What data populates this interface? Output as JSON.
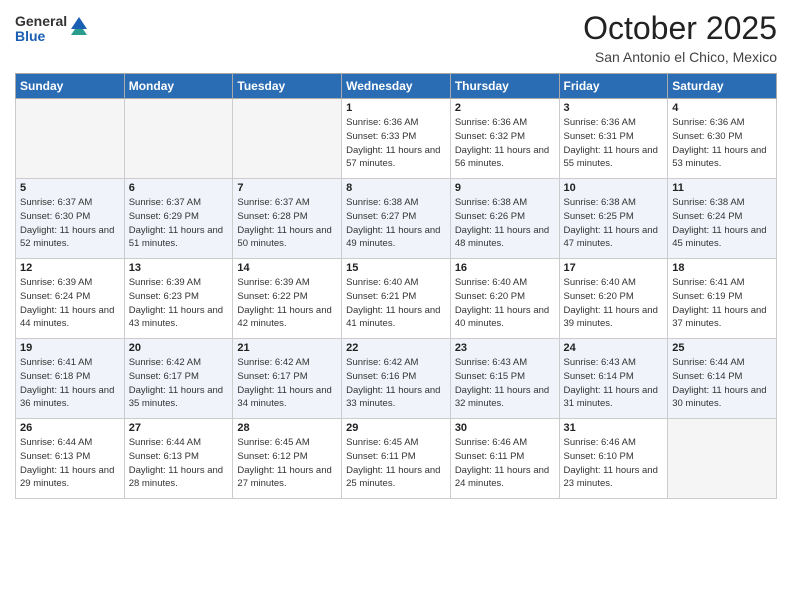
{
  "header": {
    "logo_general": "General",
    "logo_blue": "Blue",
    "month_title": "October 2025",
    "location": "San Antonio el Chico, Mexico"
  },
  "days_of_week": [
    "Sunday",
    "Monday",
    "Tuesday",
    "Wednesday",
    "Thursday",
    "Friday",
    "Saturday"
  ],
  "weeks": [
    [
      {
        "day": "",
        "info": ""
      },
      {
        "day": "",
        "info": ""
      },
      {
        "day": "",
        "info": ""
      },
      {
        "day": "1",
        "info": "Sunrise: 6:36 AM\nSunset: 6:33 PM\nDaylight: 11 hours and 57 minutes."
      },
      {
        "day": "2",
        "info": "Sunrise: 6:36 AM\nSunset: 6:32 PM\nDaylight: 11 hours and 56 minutes."
      },
      {
        "day": "3",
        "info": "Sunrise: 6:36 AM\nSunset: 6:31 PM\nDaylight: 11 hours and 55 minutes."
      },
      {
        "day": "4",
        "info": "Sunrise: 6:36 AM\nSunset: 6:30 PM\nDaylight: 11 hours and 53 minutes."
      }
    ],
    [
      {
        "day": "5",
        "info": "Sunrise: 6:37 AM\nSunset: 6:30 PM\nDaylight: 11 hours and 52 minutes."
      },
      {
        "day": "6",
        "info": "Sunrise: 6:37 AM\nSunset: 6:29 PM\nDaylight: 11 hours and 51 minutes."
      },
      {
        "day": "7",
        "info": "Sunrise: 6:37 AM\nSunset: 6:28 PM\nDaylight: 11 hours and 50 minutes."
      },
      {
        "day": "8",
        "info": "Sunrise: 6:38 AM\nSunset: 6:27 PM\nDaylight: 11 hours and 49 minutes."
      },
      {
        "day": "9",
        "info": "Sunrise: 6:38 AM\nSunset: 6:26 PM\nDaylight: 11 hours and 48 minutes."
      },
      {
        "day": "10",
        "info": "Sunrise: 6:38 AM\nSunset: 6:25 PM\nDaylight: 11 hours and 47 minutes."
      },
      {
        "day": "11",
        "info": "Sunrise: 6:38 AM\nSunset: 6:24 PM\nDaylight: 11 hours and 45 minutes."
      }
    ],
    [
      {
        "day": "12",
        "info": "Sunrise: 6:39 AM\nSunset: 6:24 PM\nDaylight: 11 hours and 44 minutes."
      },
      {
        "day": "13",
        "info": "Sunrise: 6:39 AM\nSunset: 6:23 PM\nDaylight: 11 hours and 43 minutes."
      },
      {
        "day": "14",
        "info": "Sunrise: 6:39 AM\nSunset: 6:22 PM\nDaylight: 11 hours and 42 minutes."
      },
      {
        "day": "15",
        "info": "Sunrise: 6:40 AM\nSunset: 6:21 PM\nDaylight: 11 hours and 41 minutes."
      },
      {
        "day": "16",
        "info": "Sunrise: 6:40 AM\nSunset: 6:20 PM\nDaylight: 11 hours and 40 minutes."
      },
      {
        "day": "17",
        "info": "Sunrise: 6:40 AM\nSunset: 6:20 PM\nDaylight: 11 hours and 39 minutes."
      },
      {
        "day": "18",
        "info": "Sunrise: 6:41 AM\nSunset: 6:19 PM\nDaylight: 11 hours and 37 minutes."
      }
    ],
    [
      {
        "day": "19",
        "info": "Sunrise: 6:41 AM\nSunset: 6:18 PM\nDaylight: 11 hours and 36 minutes."
      },
      {
        "day": "20",
        "info": "Sunrise: 6:42 AM\nSunset: 6:17 PM\nDaylight: 11 hours and 35 minutes."
      },
      {
        "day": "21",
        "info": "Sunrise: 6:42 AM\nSunset: 6:17 PM\nDaylight: 11 hours and 34 minutes."
      },
      {
        "day": "22",
        "info": "Sunrise: 6:42 AM\nSunset: 6:16 PM\nDaylight: 11 hours and 33 minutes."
      },
      {
        "day": "23",
        "info": "Sunrise: 6:43 AM\nSunset: 6:15 PM\nDaylight: 11 hours and 32 minutes."
      },
      {
        "day": "24",
        "info": "Sunrise: 6:43 AM\nSunset: 6:14 PM\nDaylight: 11 hours and 31 minutes."
      },
      {
        "day": "25",
        "info": "Sunrise: 6:44 AM\nSunset: 6:14 PM\nDaylight: 11 hours and 30 minutes."
      }
    ],
    [
      {
        "day": "26",
        "info": "Sunrise: 6:44 AM\nSunset: 6:13 PM\nDaylight: 11 hours and 29 minutes."
      },
      {
        "day": "27",
        "info": "Sunrise: 6:44 AM\nSunset: 6:13 PM\nDaylight: 11 hours and 28 minutes."
      },
      {
        "day": "28",
        "info": "Sunrise: 6:45 AM\nSunset: 6:12 PM\nDaylight: 11 hours and 27 minutes."
      },
      {
        "day": "29",
        "info": "Sunrise: 6:45 AM\nSunset: 6:11 PM\nDaylight: 11 hours and 25 minutes."
      },
      {
        "day": "30",
        "info": "Sunrise: 6:46 AM\nSunset: 6:11 PM\nDaylight: 11 hours and 24 minutes."
      },
      {
        "day": "31",
        "info": "Sunrise: 6:46 AM\nSunset: 6:10 PM\nDaylight: 11 hours and 23 minutes."
      },
      {
        "day": "",
        "info": ""
      }
    ]
  ]
}
